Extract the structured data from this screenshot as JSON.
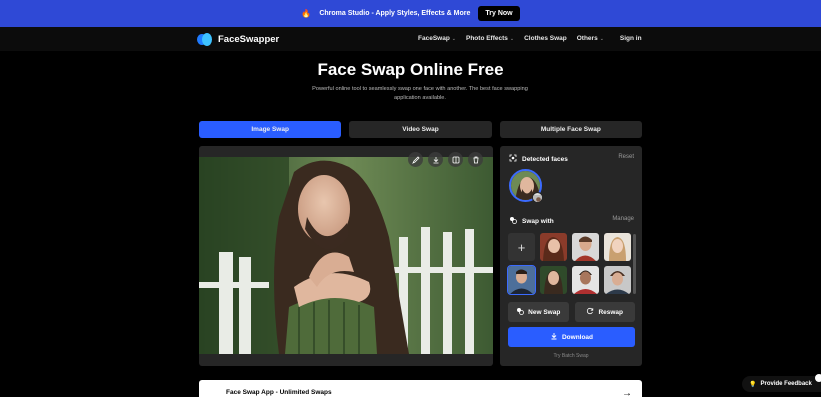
{
  "promo": {
    "text": "Chroma Studio - Apply Styles, Effects & More",
    "cta": "Try Now"
  },
  "nav": {
    "brand": "FaceSwapper",
    "menu": [
      {
        "label": "FaceSwap",
        "dropdown": true
      },
      {
        "label": "Photo Effects",
        "dropdown": true
      },
      {
        "label": "Clothes Swap",
        "dropdown": false
      },
      {
        "label": "Others",
        "dropdown": true
      },
      {
        "label": "Sign in",
        "dropdown": false
      }
    ]
  },
  "hero": {
    "title": "Face Swap Online Free",
    "subtitle": "Powerful online tool to seamlessly swap one face with another. The best face swapping application available."
  },
  "tabs": [
    {
      "label": "Image Swap",
      "active": true
    },
    {
      "label": "Video Swap",
      "active": false
    },
    {
      "label": "Multiple Face Swap",
      "active": false
    }
  ],
  "panel": {
    "detected_title": "Detected faces",
    "reset": "Reset",
    "swap_with_title": "Swap with",
    "manage": "Manage",
    "new_swap": "New Swap",
    "reswap": "Reswap",
    "download": "Download",
    "batch": "Try Batch Swap"
  },
  "app_bar": {
    "title": "Face Swap App - Unlimited Swaps"
  },
  "feedback": {
    "label": "Provide Feedback"
  },
  "colors": {
    "accent": "#2a5dff",
    "promo": "#2f49d6",
    "panel": "#262626"
  }
}
